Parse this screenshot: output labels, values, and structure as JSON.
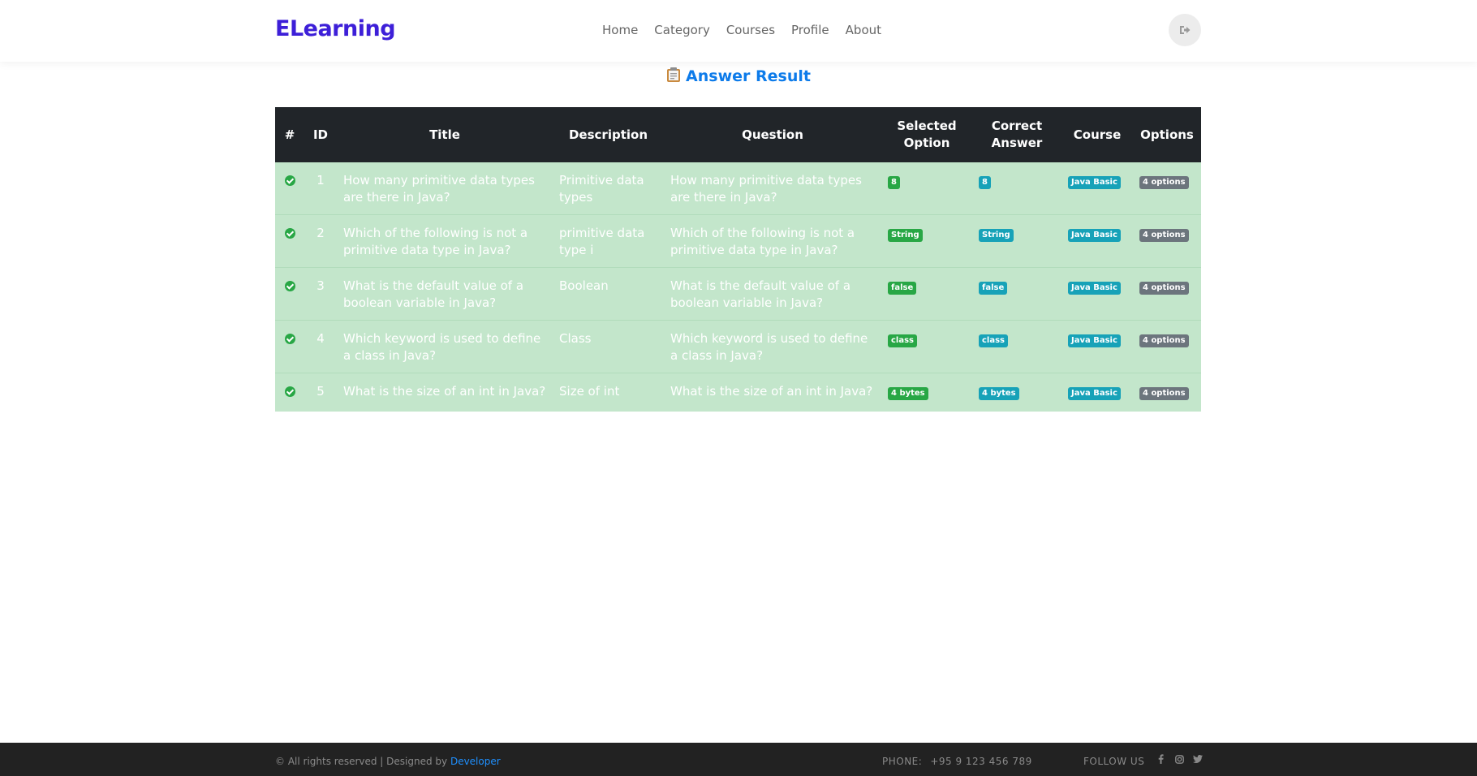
{
  "header": {
    "brand": "ELearning",
    "nav": [
      "Home",
      "Category",
      "Courses",
      "Profile",
      "About"
    ]
  },
  "page": {
    "title": "Answer Result"
  },
  "table": {
    "headers": [
      "#",
      "ID",
      "Title",
      "Description",
      "Question",
      "Selected Option",
      "Correct Answer",
      "Course",
      "Options"
    ],
    "rows": [
      {
        "id": "1",
        "title": "How many primitive data types are there in Java?",
        "description": "Primitive data types",
        "question": "How many primitive data types are there in Java?",
        "selected": "8",
        "correct": "8",
        "course": "Java Basic",
        "options": "4 options"
      },
      {
        "id": "2",
        "title": "Which of the following is not a primitive data type in Java?",
        "description": "primitive data type i",
        "question": "Which of the following is not a primitive data type in Java?",
        "selected": "String",
        "correct": "String",
        "course": "Java Basic",
        "options": "4 options"
      },
      {
        "id": "3",
        "title": "What is the default value of a boolean variable in Java?",
        "description": "Boolean",
        "question": "What is the default value of a boolean variable in Java?",
        "selected": "false",
        "correct": "false",
        "course": "Java Basic",
        "options": "4 options"
      },
      {
        "id": "4",
        "title": "Which keyword is used to define a class in Java?",
        "description": "Class",
        "question": "Which keyword is used to define a class in Java?",
        "selected": "class",
        "correct": "class",
        "course": "Java Basic",
        "options": "4 options"
      },
      {
        "id": "5",
        "title": "What is the size of an int in Java?",
        "description": "Size of int",
        "question": "What is the size of an int in Java?",
        "selected": "4 bytes",
        "correct": "4 bytes",
        "course": "Java Basic",
        "options": "4 options"
      }
    ]
  },
  "footer": {
    "copyright": "© All rights reserved | Designed by ",
    "developer": "Developer",
    "phone_label": "PHONE:",
    "phone": "+95 9 123 456 789",
    "follow": "FOLLOW US"
  },
  "icons": {
    "logout": "sign-out-icon",
    "title": "clipboard-icon",
    "row_status": "check-circle-icon",
    "social": [
      "facebook-icon",
      "instagram-icon",
      "twitter-icon"
    ]
  },
  "colors": {
    "brand": "#3d1fd8",
    "title": "#0d7bea",
    "table_head": "#212529",
    "row_success": "#c3e6cb",
    "badge_selected": "#28a745",
    "badge_correct": "#17a2b8",
    "badge_options": "#6c757d",
    "footer": "#222222",
    "footer_link": "#1e90ff"
  }
}
